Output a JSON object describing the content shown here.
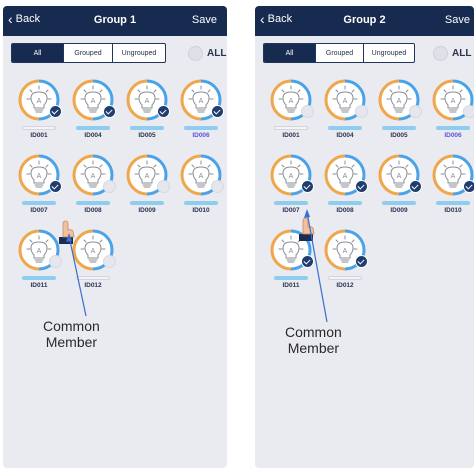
{
  "phones": [
    {
      "nav": {
        "back": "Back",
        "title": "Group 1",
        "save": "Save"
      },
      "tabs": [
        "All",
        "Grouped",
        "Ungrouped"
      ],
      "active_tab": 0,
      "all_label": "ALL",
      "devices": [
        {
          "id": "ID001",
          "checked": true,
          "bar": "empty",
          "highlight": false
        },
        {
          "id": "ID004",
          "checked": true,
          "bar": "blue",
          "highlight": false
        },
        {
          "id": "ID005",
          "checked": true,
          "bar": "blue",
          "highlight": false
        },
        {
          "id": "ID006",
          "checked": true,
          "bar": "blue",
          "highlight": true
        },
        {
          "id": "ID007",
          "checked": true,
          "bar": "blue",
          "highlight": false
        },
        {
          "id": "ID008",
          "checked": false,
          "bar": "blue",
          "highlight": false
        },
        {
          "id": "ID009",
          "checked": false,
          "bar": "blue",
          "highlight": false
        },
        {
          "id": "ID010",
          "checked": false,
          "bar": "blue",
          "highlight": false
        },
        {
          "id": "ID011",
          "checked": false,
          "bar": "blue",
          "highlight": false
        },
        {
          "id": "ID012",
          "checked": false,
          "bar": "empty",
          "highlight": false
        }
      ],
      "callout": {
        "line1": "Common",
        "line2": "Member"
      }
    },
    {
      "nav": {
        "back": "Back",
        "title": "Group 2",
        "save": "Save"
      },
      "tabs": [
        "All",
        "Grouped",
        "Ungrouped"
      ],
      "active_tab": 0,
      "all_label": "ALL",
      "devices": [
        {
          "id": "ID001",
          "checked": false,
          "bar": "empty",
          "highlight": false
        },
        {
          "id": "ID004",
          "checked": false,
          "bar": "blue",
          "highlight": false
        },
        {
          "id": "ID005",
          "checked": false,
          "bar": "blue",
          "highlight": false
        },
        {
          "id": "ID006",
          "checked": false,
          "bar": "blue",
          "highlight": true
        },
        {
          "id": "ID007",
          "checked": true,
          "bar": "blue",
          "highlight": false
        },
        {
          "id": "ID008",
          "checked": true,
          "bar": "blue",
          "highlight": false
        },
        {
          "id": "ID009",
          "checked": true,
          "bar": "blue",
          "highlight": false
        },
        {
          "id": "ID010",
          "checked": true,
          "bar": "blue",
          "highlight": false
        },
        {
          "id": "ID011",
          "checked": true,
          "bar": "blue",
          "highlight": false
        },
        {
          "id": "ID012",
          "checked": true,
          "bar": "empty",
          "highlight": false
        }
      ],
      "callout": {
        "line1": "Common",
        "line2": "Member"
      }
    }
  ],
  "colors": {
    "navbar": "#172a4f",
    "check": "#1f3d6e",
    "bar": "#8ecdf0",
    "ring_warm": "#f0a64a",
    "ring_cool": "#4aa3e6",
    "highlight_label": "#5a55d6"
  },
  "icons": {
    "device": "lightbulb-icon",
    "check": "check-icon",
    "back": "chevron-left-icon",
    "pointer": "hand-pointer-icon"
  }
}
